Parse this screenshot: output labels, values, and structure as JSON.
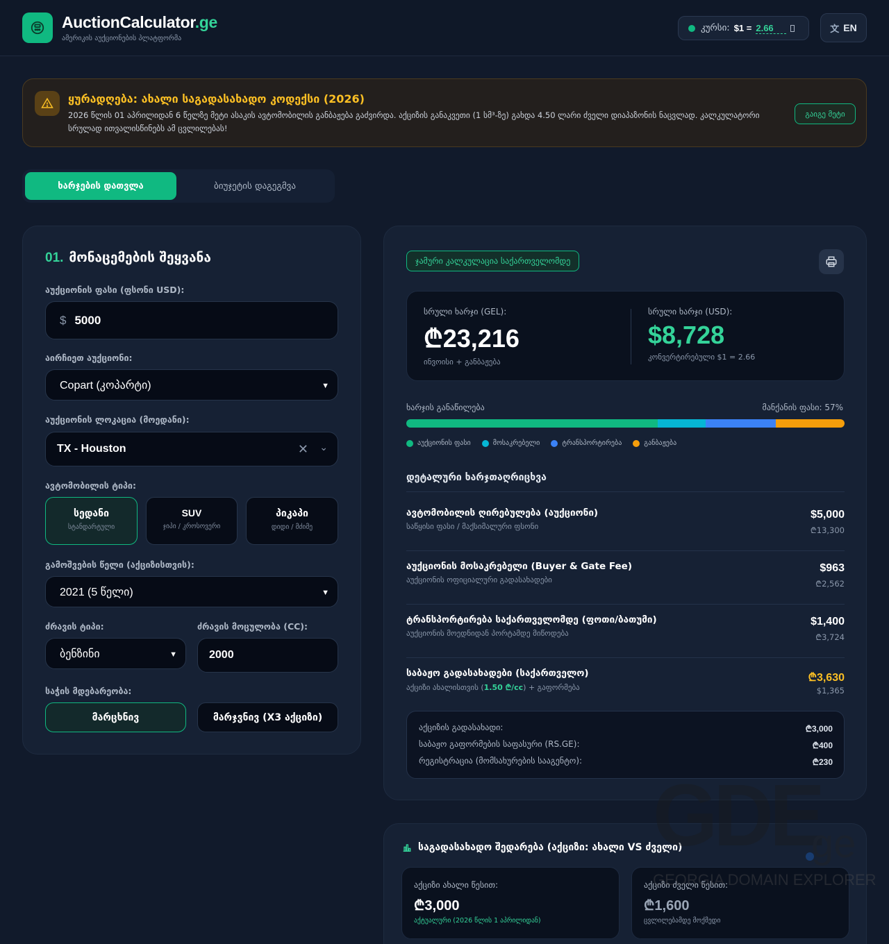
{
  "header": {
    "brand_main": "AuctionCalculator",
    "brand_suffix": ".ge",
    "tagline": "ამერიკის აუქციონების პლატფორმა",
    "rate_label": "კურსი:",
    "rate_dollar": "$1 =",
    "rate_value": "2.66",
    "lang": "EN",
    "lang_icon": "translate-icon"
  },
  "alert": {
    "title": "ყურადღება: ახალი საგადასახადო კოდექსი (2026)",
    "text": "2026 წლის 01 აპრილიდან 6 წელზე მეტი ასაკის ავტომობილის განბაჟება გაძვირდა. აქციზის განაკვეთი (1 სმ³-ზე) გახდა 4.50 ლარი ძველი დიაპაზონის ნაცვლად. კალკულატორი სრულად ითვალისწინებს ამ ცვლილებას!",
    "more": "გაიგე მეტი"
  },
  "tabs": [
    "ხარჯების დათვლა",
    "ბიუჯეტის დაგეგმვა"
  ],
  "form": {
    "section_num": "01.",
    "section_title": "მონაცემების შეყვანა",
    "price_label": "აუქციონის ფასი (ფსონი USD):",
    "price_currency": "$",
    "price_value": "5000",
    "auction_label": "აირჩიეთ აუქციონი:",
    "auction_value": "Copart (კოპარტი)",
    "location_label": "აუქციონის ლოკაცია (მოედანი):",
    "location_value": "TX - Houston",
    "type_label": "ავტომობილის ტიპი:",
    "types": [
      {
        "title": "სედანი",
        "sub": "სტანდარტული"
      },
      {
        "title": "SUV",
        "sub": "ჯიპი / კროსოვერი"
      },
      {
        "title": "პიკაპი",
        "sub": "დიდი / მძიმე"
      }
    ],
    "year_label": "გამოშვების წელი (აქციზისთვის):",
    "year_value": "2021 (5 წელი)",
    "engine_label": "ძრავის ტიპი:",
    "engine_value": "ბენზინი",
    "cc_label": "ძრავის მოცულობა (CC):",
    "cc_value": "2000",
    "wheel_label": "საჭის მდებარეობა:",
    "wheels": [
      "მარცხნივ",
      "მარჯვნივ (X3 აქციზი)"
    ]
  },
  "result": {
    "badge": "ჯამური კალკულაცია საქართველომდე",
    "gel_label": "სრული ხარჯი (GEL):",
    "gel_value": "₾23,216",
    "gel_sub": "ინვოისი + განბაჟება",
    "usd_label": "სრული ხარჯი (USD):",
    "usd_value": "$8,728",
    "usd_sub": "კონვერტირებული $1 = 2.66",
    "breakdown_label": "ხარჯის განაწილება",
    "car_share": "მანქანის ფასი: 57%",
    "bar_colors": [
      "#10b981",
      "#06b6d4",
      "#3b82f6",
      "#f59e0b"
    ],
    "bar_fractions": [
      57.3,
      11.0,
      16.0,
      15.7
    ],
    "legend": [
      "აუქციონის ფასი",
      "მოსაკრებელი",
      "ტრანსპორტირება",
      "განბაჟება"
    ],
    "detail_title": "დეტალური ხარჯთაღრიცხვა",
    "rows": [
      {
        "title": "ავტომობილის ღირებულება (აუქციონი)",
        "sub": "საწყისი ფასი / მაქსიმალური ფსონი",
        "usd": "$5,000",
        "gel": "₾13,300"
      },
      {
        "title": "აუქციონის მოსაკრებელი (Buyer & Gate Fee)",
        "sub": "აუქციონის ოფიციალური გადასახადები",
        "usd": "$963",
        "gel": "₾2,562"
      },
      {
        "title": "ტრანსპორტირება საქართველომდე (ფოთი/ბათუმი)",
        "sub": "აუქციონის მოედნიდან პორტამდე მიწოდება",
        "usd": "$1,400",
        "gel": "₾3,724"
      },
      {
        "title": "საბაჟო გადასახადები (საქართველო)",
        "sub_pre": "აქციზი ახალისთვის (",
        "sub_rate": "1.50 ₾/cc",
        "sub_post": ") + გაფორმება",
        "gel_main": "₾3,630",
        "usd_sub": "$1,365"
      }
    ],
    "customs": [
      {
        "label": "აქციზის გადასახადი:",
        "value": "₾3,000"
      },
      {
        "label": "საბაჟო გაფორმების საფასური (RS.GE):",
        "value": "₾400"
      },
      {
        "label": "რეგისტრაცია (მომსახურების სააგენტო):",
        "value": "₾230"
      }
    ]
  },
  "compare": {
    "title": "საგადასახადო შედარება (აქციზი: ახალი VS ძველი)",
    "new_label": "აქციზი ახალი წესით:",
    "new_value": "₾3,000",
    "new_note": "აქტუალური (2026 წლის 1 აპრილიდან)",
    "old_label": "აქციზი ძველი წესით:",
    "old_value": "₾1,600",
    "old_note": "ცვლილებამდე მოქმედი"
  },
  "watermark": {
    "text": "GDE",
    "suffix": "ge",
    "sub": "GEORGIA DOMAIN EXPLORER"
  }
}
